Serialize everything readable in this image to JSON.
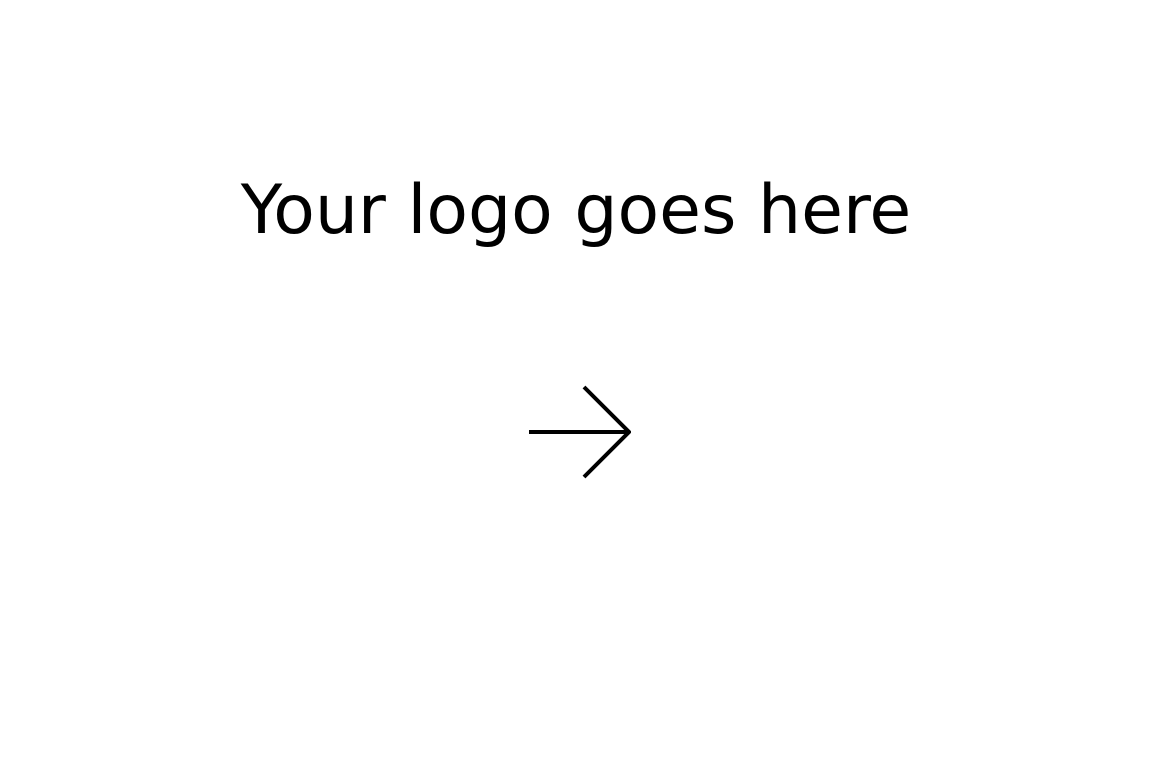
{
  "logo": {
    "placeholder_text": "Your logo goes here"
  },
  "next": {
    "icon": "arrow-right-icon",
    "color": "#000000"
  },
  "colors": {
    "background": "#ffffff",
    "foreground": "#000000"
  }
}
